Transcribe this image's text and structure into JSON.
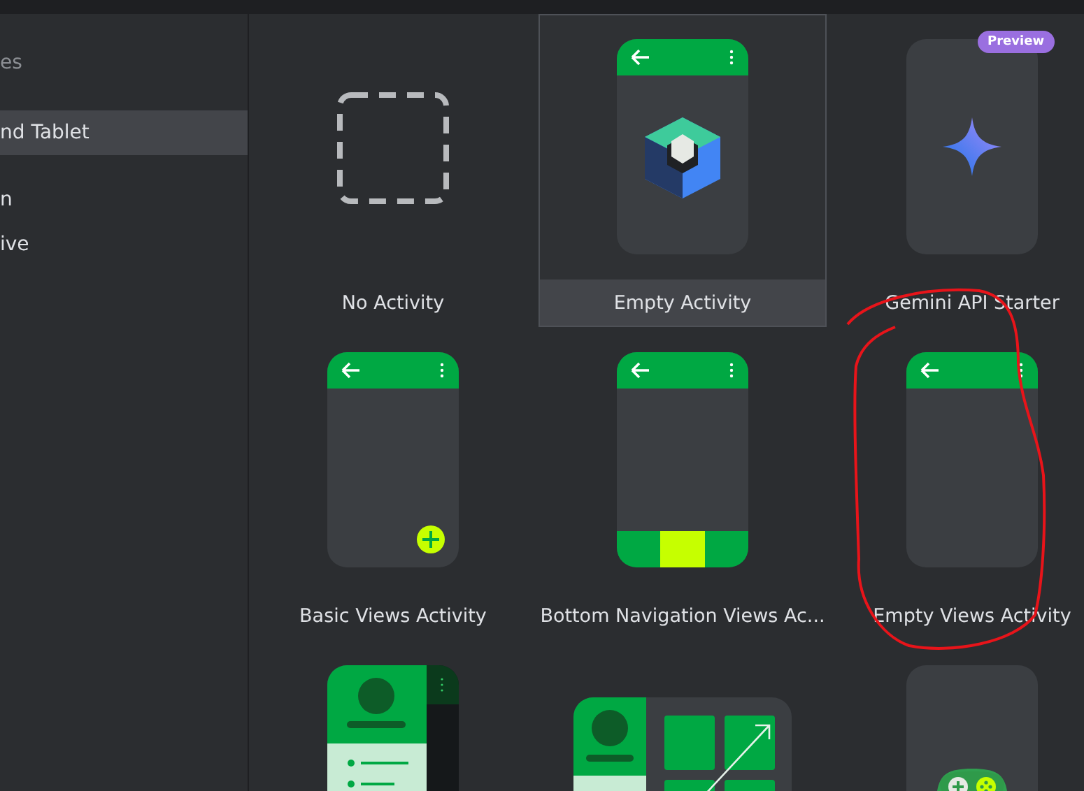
{
  "sidebar": {
    "items": [
      {
        "label": "es",
        "kind": "heading"
      },
      {
        "label": "nd Tablet",
        "kind": "item",
        "selected": true
      },
      {
        "label": "n",
        "kind": "item",
        "selected": false
      },
      {
        "label": "ive",
        "kind": "item",
        "selected": false
      }
    ]
  },
  "templates": [
    {
      "name": "No Activity",
      "kind": "blank",
      "selected": false
    },
    {
      "name": "Empty Activity",
      "kind": "compose",
      "selected": true
    },
    {
      "name": "Gemini API Starter",
      "kind": "gemini",
      "selected": false,
      "badge": "Preview"
    },
    {
      "name": "Basic Views Activity",
      "kind": "basic",
      "selected": false
    },
    {
      "name": "Bottom Navigation Views Ac...",
      "kind": "bottomnav",
      "selected": false
    },
    {
      "name": "Empty Views Activity",
      "kind": "views",
      "selected": false
    },
    {
      "kind": "drawer",
      "selected": false
    },
    {
      "kind": "responsive",
      "selected": false
    },
    {
      "kind": "game",
      "selected": false
    }
  ]
}
